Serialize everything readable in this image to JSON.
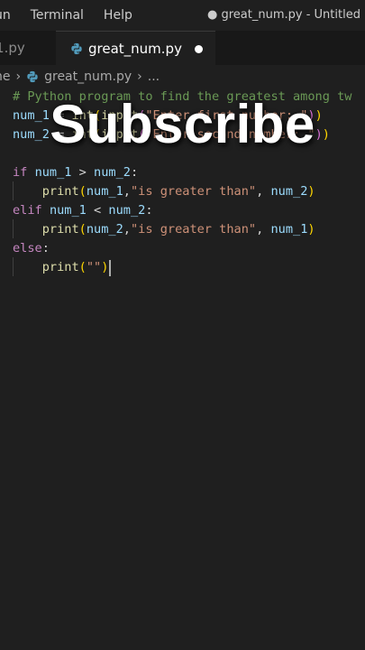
{
  "menubar": {
    "items": [
      "un",
      "Terminal",
      "Help"
    ],
    "window_title": "● great_num.py - Untitled (Wo"
  },
  "tabs": [
    {
      "label": ":1.py",
      "active": false
    },
    {
      "label": "great_num.py",
      "active": true
    }
  ],
  "breadcrumb": {
    "parts": [
      "ne",
      "great_num.py",
      "..."
    ]
  },
  "code_lines": [
    [
      {
        "t": "# Python program to find the greatest among tw",
        "c": "comment"
      }
    ],
    [
      {
        "t": "num_1",
        "c": "var"
      },
      {
        "t": " = ",
        "c": "op"
      },
      {
        "t": "int",
        "c": "fn"
      },
      {
        "t": "(",
        "c": "p1"
      },
      {
        "t": "input",
        "c": "fn"
      },
      {
        "t": "(",
        "c": "p2"
      },
      {
        "t": "\"Enter first number: \"",
        "c": "str"
      },
      {
        "t": ")",
        "c": "p2"
      },
      {
        "t": ")",
        "c": "p1"
      }
    ],
    [
      {
        "t": "num_2",
        "c": "var"
      },
      {
        "t": " = ",
        "c": "op"
      },
      {
        "t": "int",
        "c": "fn"
      },
      {
        "t": "(",
        "c": "p1"
      },
      {
        "t": "input",
        "c": "fn"
      },
      {
        "t": "(",
        "c": "p2"
      },
      {
        "t": "\"Enter second number: \"",
        "c": "str"
      },
      {
        "t": ")",
        "c": "p2"
      },
      {
        "t": ")",
        "c": "p1"
      }
    ],
    [],
    [
      {
        "t": "if",
        "c": "kw"
      },
      {
        "t": " ",
        "c": "op"
      },
      {
        "t": "num_1",
        "c": "var"
      },
      {
        "t": " > ",
        "c": "op"
      },
      {
        "t": "num_2",
        "c": "var"
      },
      {
        "t": ":",
        "c": "op"
      }
    ],
    [
      {
        "t": "    ",
        "c": "op"
      },
      {
        "t": "print",
        "c": "fn"
      },
      {
        "t": "(",
        "c": "p1"
      },
      {
        "t": "num_1",
        "c": "var"
      },
      {
        "t": ",",
        "c": "op"
      },
      {
        "t": "\"is greater than\"",
        "c": "str"
      },
      {
        "t": ", ",
        "c": "op"
      },
      {
        "t": "num_2",
        "c": "var"
      },
      {
        "t": ")",
        "c": "p1"
      }
    ],
    [
      {
        "t": "elif",
        "c": "kw"
      },
      {
        "t": " ",
        "c": "op"
      },
      {
        "t": "num_1",
        "c": "var"
      },
      {
        "t": " < ",
        "c": "op"
      },
      {
        "t": "num_2",
        "c": "var"
      },
      {
        "t": ":",
        "c": "op"
      }
    ],
    [
      {
        "t": "    ",
        "c": "op"
      },
      {
        "t": "print",
        "c": "fn"
      },
      {
        "t": "(",
        "c": "p1"
      },
      {
        "t": "num_2",
        "c": "var"
      },
      {
        "t": ",",
        "c": "op"
      },
      {
        "t": "\"is greater than\"",
        "c": "str"
      },
      {
        "t": ", ",
        "c": "op"
      },
      {
        "t": "num_1",
        "c": "var"
      },
      {
        "t": ")",
        "c": "p1"
      }
    ],
    [
      {
        "t": "else",
        "c": "kw"
      },
      {
        "t": ":",
        "c": "op"
      }
    ],
    [
      {
        "t": "    ",
        "c": "op"
      },
      {
        "t": "print",
        "c": "fn"
      },
      {
        "t": "(",
        "c": "p1"
      },
      {
        "t": "\"\"",
        "c": "str"
      },
      {
        "t": ")",
        "c": "p1"
      }
    ]
  ],
  "overlay_text": "Subscribe",
  "colors": {
    "python_icon_blue": "#519aba",
    "editor_bg": "#1f1f1f"
  }
}
